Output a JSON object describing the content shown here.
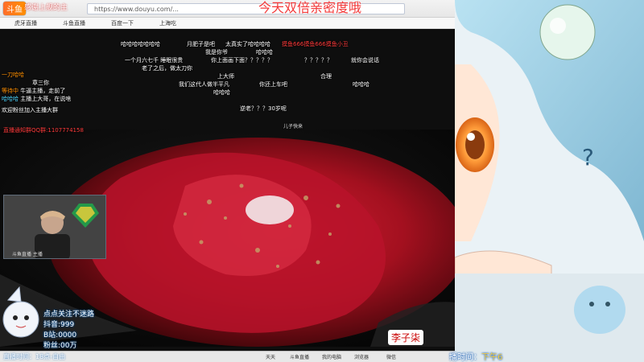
{
  "browser": {
    "url": "https://www.douyu.com/...",
    "tabs": [
      "虎牙直播",
      "斗鱼直播",
      "百度一下",
      "上海吃"
    ],
    "thanks_text": "感谢上舰的主",
    "logo_text": "斗鱼"
  },
  "overlay": {
    "title": "今天双倍亲密度哦"
  },
  "danmu": {
    "lines": [
      {
        "text": "哈哈哈哈哈哈哈",
        "color": "white"
      },
      {
        "text": "月肥子是吧",
        "color": "white"
      },
      {
        "text": "太真实了哈哈哈哈",
        "color": "white"
      },
      {
        "text": "摸鱼666摸鱼666摸鱼小丑",
        "color": "red"
      },
      {
        "text": "我是你爷",
        "color": "white"
      },
      {
        "text": "哈哈哈",
        "color": "white"
      },
      {
        "text": "一个月六七千  睡眠很贵",
        "color": "white"
      },
      {
        "text": "你上面画下面？？？？？",
        "color": "white"
      },
      {
        "text": "？？？？？",
        "color": "white"
      },
      {
        "text": "就你会说话",
        "color": "white"
      },
      {
        "text": "老了之后，做太刀你",
        "color": "white"
      },
      {
        "text": "上大师",
        "color": "white"
      },
      {
        "text": "合理",
        "color": "white"
      },
      {
        "text": "哈哈哈",
        "color": "white"
      },
      {
        "text": "我们这代人做半平凡",
        "color": "white"
      },
      {
        "text": "你还上车吧",
        "color": "white"
      },
      {
        "text": "哈哈哈",
        "color": "white"
      },
      {
        "text": "逆老？？？30岁呢",
        "color": "white"
      },
      {
        "text": "儿子快来",
        "color": "white"
      }
    ]
  },
  "chat": {
    "lines": [
      {
        "name": "一刀哈哈",
        "text": ""
      },
      {
        "name": "章三你",
        "text": ""
      },
      {
        "name": "等待中",
        "text": "牛逼主播，走前了"
      },
      {
        "name": "哈哈哈",
        "text": "主播上大哥，在说啥"
      },
      {
        "name": "",
        "text": "欢迎粉丝加入主播大群"
      }
    ],
    "qq": "直播通知群QQ群:1107774158"
  },
  "cam": {
    "label": "斗鱼直播 主播"
  },
  "sticker": {
    "lines": [
      "点点关注不迷路",
      "抖音:999",
      "B站:0000",
      "粉丝:00万"
    ]
  },
  "live_time": "直播时间：18点-自由",
  "watermark": "李子柒",
  "right_time": {
    "label": "播时间：",
    "value": "下午6"
  },
  "taskbar": {
    "items": [
      "天天",
      "斗鱼直播",
      "我的电脑",
      "浏览器",
      "微信"
    ]
  }
}
